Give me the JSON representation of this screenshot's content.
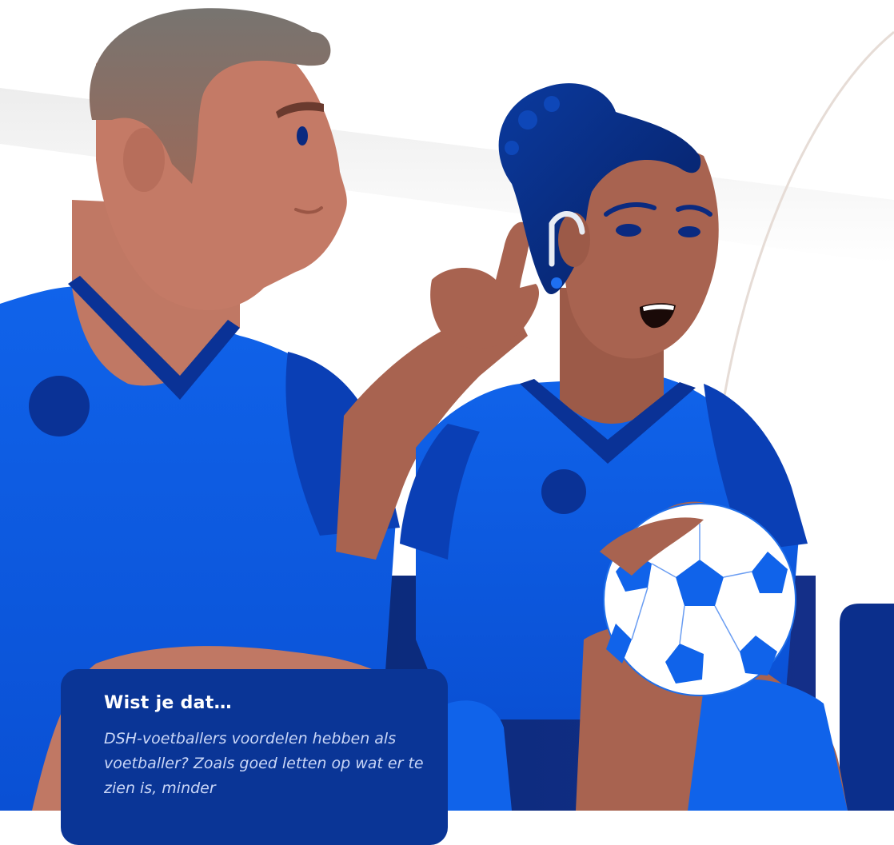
{
  "colors": {
    "kit_blue": "#0f5ee8",
    "kit_dark_blue": "#0a3596",
    "skin_man": "#c47a66",
    "skin_woman": "#a86350",
    "hair_man": "#747069",
    "hair_woman": "#0a2f86",
    "card_bg": "#0a3596"
  },
  "icons": {
    "hearing_aid": "hearing-aid-icon"
  },
  "card": {
    "title": "Wist je dat…",
    "body": "DSH-voetballers voordelen hebben als voetballer? Zoals goed letten op wat er te zien is, minder"
  }
}
